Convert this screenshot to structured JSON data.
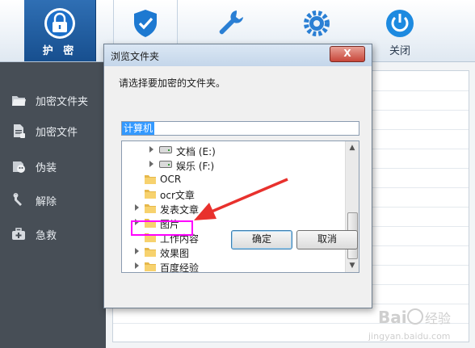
{
  "toolbar": {
    "protect_label": "护 密",
    "close_label": "关闭",
    "colors": {
      "protect_bg": "#1f5b9e",
      "shield": "#1d79d1"
    }
  },
  "sidebar": {
    "items": [
      {
        "label": "加密文件夹",
        "icon": "folder-open-icon"
      },
      {
        "label": "加密文件",
        "icon": "document-icon"
      },
      {
        "label": "伪装",
        "icon": "disguise-icon"
      },
      {
        "label": "解除",
        "icon": "unlock-icon"
      },
      {
        "label": "急救",
        "icon": "first-aid-kit-icon"
      }
    ]
  },
  "dialog": {
    "title": "浏览文件夹",
    "close_symbol": "X",
    "prompt": "请选择要加密的文件夹。",
    "path_value": "计算机",
    "tree": [
      {
        "label": "文档 (E:)",
        "type": "drive",
        "expandable": true
      },
      {
        "label": "娱乐 (F:)",
        "type": "drive",
        "expandable": true
      },
      {
        "label": "OCR",
        "type": "folder",
        "expandable": false
      },
      {
        "label": "ocr文章",
        "type": "folder",
        "expandable": false
      },
      {
        "label": "发表文章",
        "type": "folder",
        "expandable": true
      },
      {
        "label": "图片",
        "type": "folder",
        "expandable": true
      },
      {
        "label": "工作内容",
        "type": "folder",
        "expandable": false
      },
      {
        "label": "效果图",
        "type": "folder",
        "expandable": true
      },
      {
        "label": "百度经验",
        "type": "folder",
        "expandable": true
      }
    ],
    "ok_label": "确定",
    "cancel_label": "取消"
  },
  "annotation": {
    "highlight_color": "#ff00ff",
    "arrow_color": "#e8312d"
  },
  "watermark": {
    "brand": "Baidu经验",
    "url": "jingyan.baidu.com"
  }
}
